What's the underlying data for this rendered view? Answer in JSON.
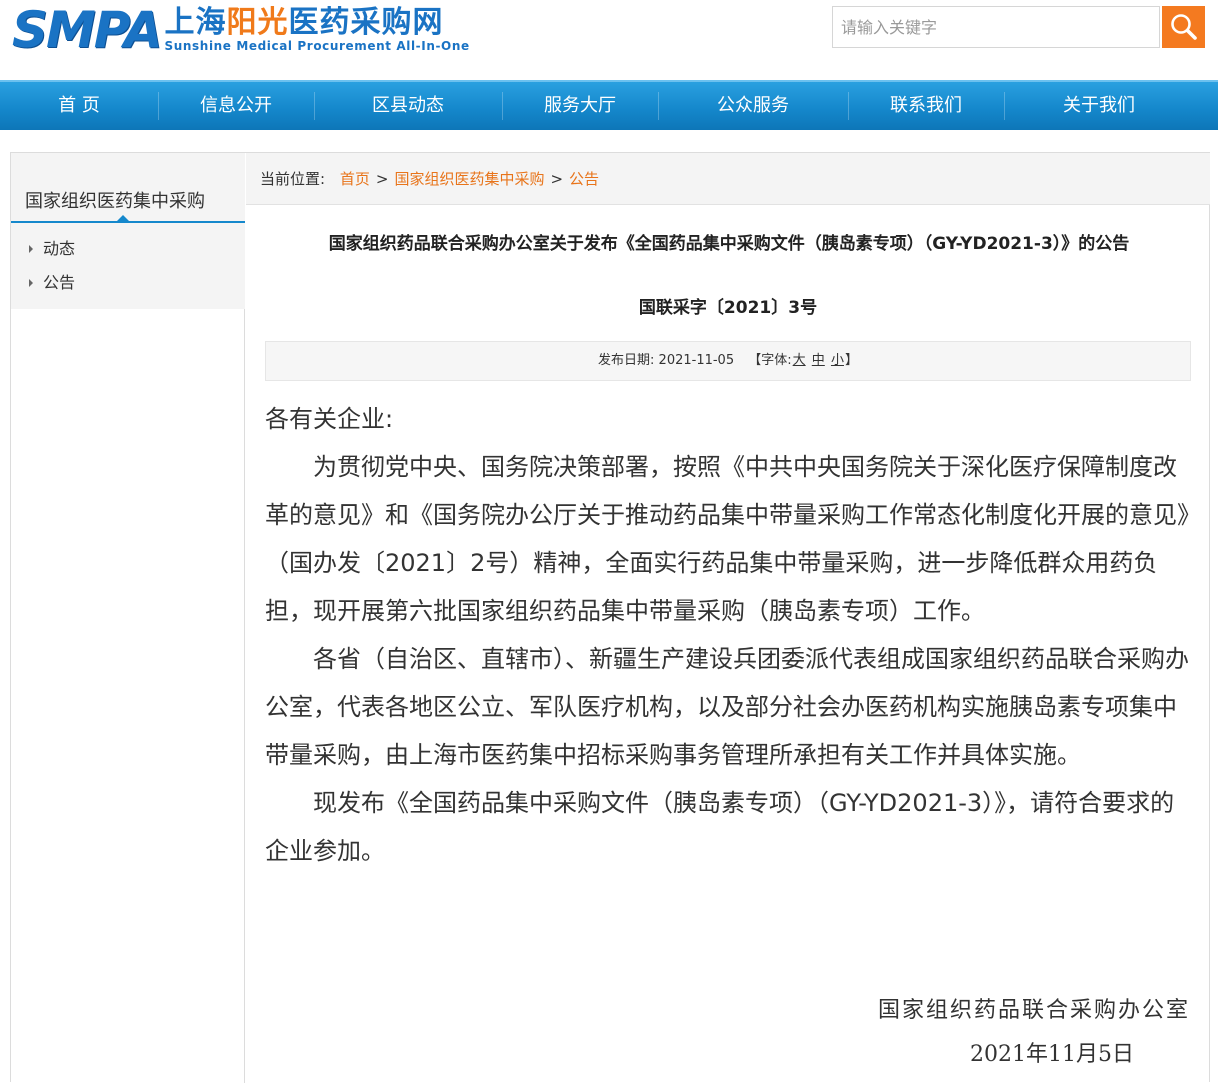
{
  "header": {
    "logo_mark": "SMPA",
    "logo_cn_part1": "上海",
    "logo_cn_part2": "阳光",
    "logo_cn_part3": "医药采购网",
    "logo_en": "Sunshine Medical Procurement All-In-One",
    "search_placeholder": "请输入关键字",
    "search_icon": "search-icon",
    "brand_blue": "#1a73c4",
    "accent_orange": "#f47a20"
  },
  "nav": {
    "items": [
      {
        "label": "首 页"
      },
      {
        "label": "信息公开"
      },
      {
        "label": "区县动态"
      },
      {
        "label": "服务大厅"
      },
      {
        "label": "公众服务"
      },
      {
        "label": "联系我们"
      },
      {
        "label": "关于我们"
      }
    ]
  },
  "sidebar": {
    "title": "国家组织医药集中采购",
    "items": [
      {
        "label": "动态"
      },
      {
        "label": "公告"
      }
    ]
  },
  "breadcrumb": {
    "prefix": "当前位置:",
    "items": [
      "首页",
      "国家组织医药集中采购",
      "公告"
    ],
    "separator": ">"
  },
  "article": {
    "title": "国家组织药品联合采购办公室关于发布《全国药品集中采购文件（胰岛素专项）（GY-YD2021-3）》的公告",
    "doc_number": "国联采字〔2021〕3号",
    "info": {
      "date_label": "发布日期:",
      "date": "2021-11-05",
      "font_label": "【字体:",
      "font_large": "大",
      "font_medium": "中",
      "font_small": "小",
      "font_close": "】"
    },
    "salutation": "各有关企业:",
    "paragraphs": [
      "为贯彻党中央、国务院决策部署，按照《中共中央国务院关于深化医疗保障制度改革的意见》和《国务院办公厅关于推动药品集中带量采购工作常态化制度化开展的意见》（国办发〔2021〕2号）精神，全面实行药品集中带量采购，进一步降低群众用药负担，现开展第六批国家组织药品集中带量采购（胰岛素专项）工作。",
      "各省（自治区、直辖市）、新疆生产建设兵团委派代表组成国家组织药品联合采购办公室，代表各地区公立、军队医疗机构，以及部分社会办医药机构实施胰岛素专项集中带量采购，由上海市医药集中招标采购事务管理所承担有关工作并具体实施。",
      "现发布《全国药品集中采购文件（胰岛素专项）（GY-YD2021-3）》，请符合要求的企业参加。"
    ],
    "signature_org": "国家组织药品联合采购办公室",
    "signature_date": "2021年11月5日"
  }
}
